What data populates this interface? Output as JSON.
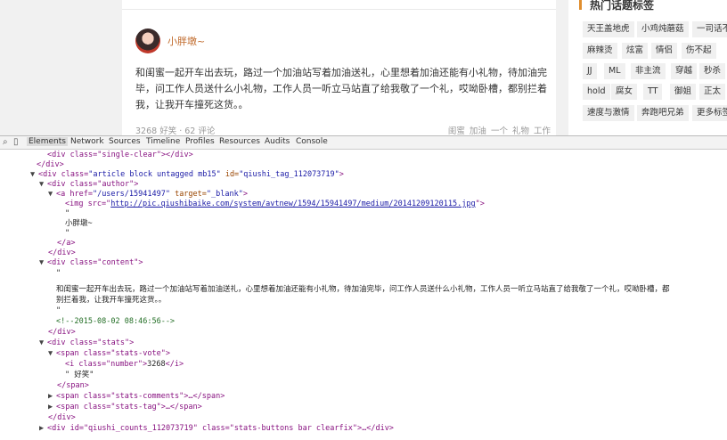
{
  "page": {
    "author_name": "小胖墩~",
    "content_line1": "和闺蜜一起开车出去玩，路过一个加油站写着加油送礼，心里想着加油还能有小礼物，待加油完",
    "content_line2": "毕，问工作人员送什么小礼物，工作人员一听立马站直了给我敬了一个礼，哎呦卧槽，都别拦着",
    "content_line3": "我，让我开车撞死这货。。",
    "stats": "3268 好笑 · 62 评论",
    "tags": "闺蜜 加油 一个 礼物 工作"
  },
  "sidebar": {
    "title": "热门话题标签",
    "tags": [
      "天王盖地虎",
      "小鸡炖蘑菇",
      "一司话不",
      "麻辣烫",
      "炫富",
      "情侣",
      "伤不起",
      "JJ",
      "ML",
      "非主流",
      "穿越",
      "秒杀",
      "hold",
      "腐女",
      "TT",
      "御姐",
      "正太",
      "速度与激情",
      "奔跑吧兄弟",
      "更多标签"
    ]
  },
  "devtools": {
    "tabs": [
      "Elements",
      "Network",
      "Sources",
      "Timeline",
      "Profiles",
      "Resources",
      "Audits",
      "Console"
    ],
    "active_tab": "Elements",
    "lines": {
      "l0": "<div class=\"single-clear\"></div>",
      "l1": "</div>",
      "l2_open": "<div class=",
      "l2_class": "\"article block untagged mb15\"",
      "l2_id_attr": " id=",
      "l2_id": "\"qiushi_tag_112073719\"",
      "l2_close": ">",
      "l3": "<div class=\"author\">",
      "l4_open": "<a href=",
      "l4_href": "\"/users/15941497\"",
      "l4_target": " target=",
      "l4_target_val": "\"_blank\"",
      "l4_close": ">",
      "l5_open": "<img src=\"",
      "l5_url": "http://pic.qiushibaike.com/system/avtnew/1594/15941497/medium/20141209120115.jpg",
      "l5_close": "\">",
      "l6": "\"",
      "l7": "小胖墩~",
      "l8": "\"",
      "l9": "</a>",
      "l10": "</div>",
      "l11": "<div class=\"content\">",
      "l12": "\"",
      "l13": "和闺蜜一起开车出去玩，路过一个加油站写着加油送礼，心里想着加油还能有小礼物，待加油完毕，问工作人员送什么小礼物，工作人员一听立马站直了给我敬了一个礼，哎呦卧槽，都",
      "l14": "别拦着我，让我开车撞死这货。。",
      "l15": "\"",
      "l16": "<!--2015-08-02 08:46:56-->",
      "l17": "</div>",
      "l18": "<div class=\"stats\">",
      "l19": "<span class=\"stats-vote\">",
      "l20_open": "<i class=\"number\">",
      "l20_val": "3268",
      "l20_close": "</i>",
      "l21": "\" 好笑\"",
      "l22": "</span>",
      "l23": "<span class=\"stats-comments\">…</span>",
      "l24": "<span class=\"stats-tag\">…</span>",
      "l25": "</div>",
      "l26": "<div id=\"qiushi_counts_112073719\" class=\"stats-buttons bar clearfix\">…</div>"
    }
  }
}
